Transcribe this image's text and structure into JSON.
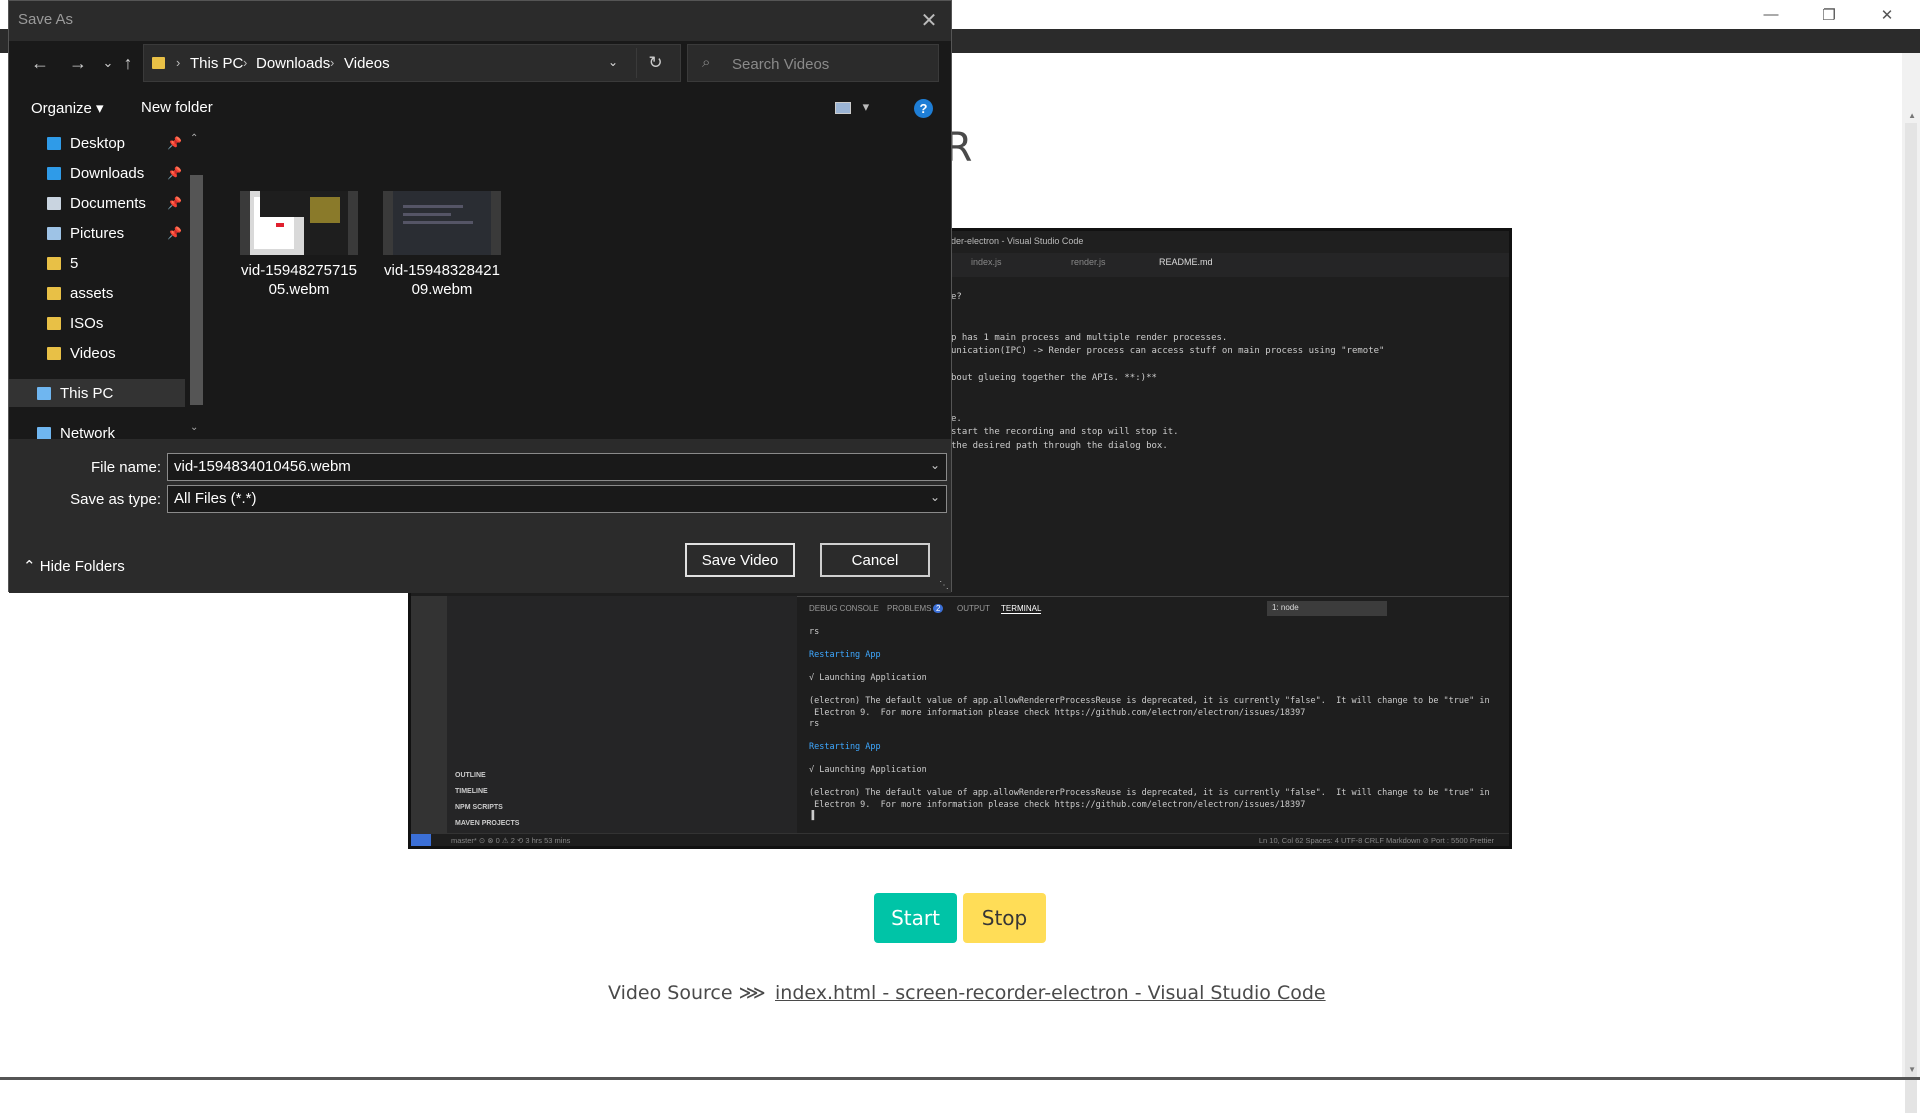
{
  "app": {
    "heading": "SCREEN RECORDER",
    "start_label": "Start",
    "stop_label": "Stop",
    "source_label": "Video Source ⋙",
    "source_link": "index.html - screen-recorder-electron - Visual Studio Code",
    "window_controls": {
      "minimize": "—",
      "maximize": "❐",
      "close": "✕"
    },
    "colors": {
      "start": "#00c4a7",
      "stop": "#ffdd57"
    }
  },
  "preview": {
    "title": "der-electron - Visual Studio Code",
    "tabs": [
      "index.js",
      "render.js",
      "README.md"
    ],
    "editor_lines": [
      "e?",
      "",
      "",
      "p has 1 main process and multiple render processes.",
      "unication(IPC) -> Render process can access stuff on main process using \"remote\"",
      "",
      "bout glueing together the APIs. **:)**",
      "",
      "",
      "e.",
      "start the recording and stop will stop it.",
      "the desired path through the dialog box."
    ],
    "side_items": [
      "OUTLINE",
      "TIMELINE",
      "NPM SCRIPTS",
      "MAVEN PROJECTS"
    ],
    "panel_tabs": [
      "DEBUG CONSOLE",
      "PROBLEMS",
      "OUTPUT",
      "TERMINAL"
    ],
    "problems_count": "2",
    "terminal_select": "1: node",
    "terminal_lines": [
      {
        "text": "rs",
        "style": "normal"
      },
      {
        "text": "",
        "style": "normal"
      },
      {
        "text": "Restarting App",
        "style": "blue"
      },
      {
        "text": "",
        "style": "normal"
      },
      {
        "text": "√ Launching Application",
        "style": "normal"
      },
      {
        "text": "",
        "style": "normal"
      },
      {
        "text": "(electron) The default value of app.allowRendererProcessReuse is deprecated, it is currently \"false\".  It will change to be \"true\" in",
        "style": "normal"
      },
      {
        "text": " Electron 9.  For more information please check https://github.com/electron/electron/issues/18397",
        "style": "normal"
      },
      {
        "text": "rs",
        "style": "normal"
      },
      {
        "text": "",
        "style": "normal"
      },
      {
        "text": "Restarting App",
        "style": "blue"
      },
      {
        "text": "",
        "style": "normal"
      },
      {
        "text": "√ Launching Application",
        "style": "normal"
      },
      {
        "text": "",
        "style": "normal"
      },
      {
        "text": "(electron) The default value of app.allowRendererProcessReuse is deprecated, it is currently \"false\".  It will change to be \"true\" in",
        "style": "normal"
      },
      {
        "text": " Electron 9.  For more information please check https://github.com/electron/electron/issues/18397",
        "style": "normal"
      },
      {
        "text": "▐",
        "style": "normal"
      }
    ],
    "status_left": "master*   ⊙   ⊗ 0 ⚠ 2   ⟲ 3 hrs 53 mins",
    "status_right": "Ln 10, Col 62    Spaces: 4    UTF-8    CRLF    Markdown    ⊘ Port : 5500    Prettier"
  },
  "dialog": {
    "title": "Save As",
    "close_glyph": "✕",
    "nav": {
      "back": "←",
      "forward": "→",
      "recent": "⌄",
      "up": "↑",
      "refresh": "↻",
      "dropdown": "⌄"
    },
    "breadcrumbs": [
      "This PC",
      "Downloads",
      "Videos"
    ],
    "breadcrumb_sep": "›",
    "search_placeholder": "Search Videos",
    "search_glyph": "⌕",
    "organize_label": "Organize ▾",
    "new_folder_label": "New folder",
    "view_caret": "▾",
    "help_glyph": "?",
    "nav_items": [
      {
        "label": "Desktop",
        "icon": "desktop-icon",
        "color": "#2f9be8",
        "pinned": true
      },
      {
        "label": "Downloads",
        "icon": "download-icon",
        "color": "#2f9be8",
        "pinned": true
      },
      {
        "label": "Documents",
        "icon": "documents-icon",
        "color": "#c9d4e0",
        "pinned": true
      },
      {
        "label": "Pictures",
        "icon": "pictures-icon",
        "color": "#9ec3e6",
        "pinned": true
      },
      {
        "label": "5",
        "icon": "folder-icon",
        "color": "#e8c046",
        "pinned": false
      },
      {
        "label": "assets",
        "icon": "folder-icon",
        "color": "#e8c046",
        "pinned": false
      },
      {
        "label": "ISOs",
        "icon": "folder-icon",
        "color": "#e8c046",
        "pinned": false
      },
      {
        "label": "Videos",
        "icon": "folder-icon",
        "color": "#e8c046",
        "pinned": false
      },
      {
        "label": "This PC",
        "icon": "computer-icon",
        "color": "#6fb6f0",
        "pinned": false
      },
      {
        "label": "Network",
        "icon": "network-icon",
        "color": "#6fb6f0",
        "pinned": false
      }
    ],
    "pin_glyph": "📌",
    "files": [
      {
        "name_line1": "vid-15948275715",
        "name_line2": "05.webm"
      },
      {
        "name_line1": "vid-15948328421",
        "name_line2": "09.webm"
      }
    ],
    "file_name_label": "File name:",
    "file_name_value": "vid-1594834010456.webm",
    "save_type_label": "Save as type:",
    "save_type_value": "All Files (*.*)",
    "hide_folders_label": "⌃  Hide Folders",
    "save_label": "Save Video",
    "cancel_label": "Cancel"
  }
}
